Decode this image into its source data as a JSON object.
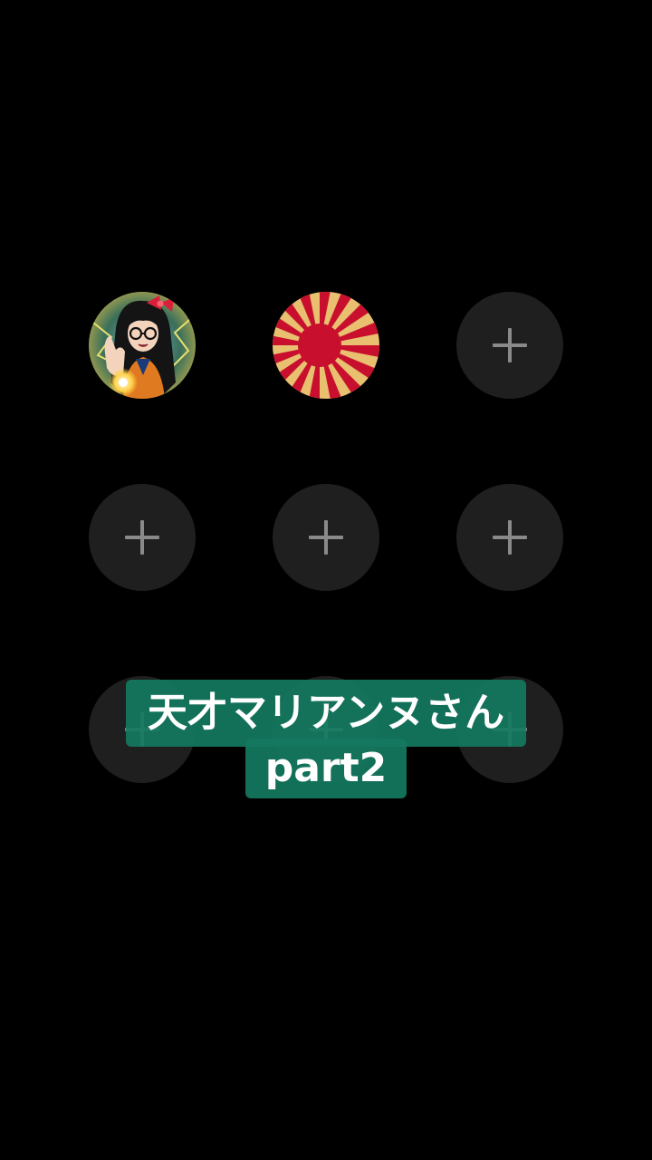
{
  "slots": [
    {
      "row": 1,
      "col": 1,
      "state": "filled",
      "icon": "anime-girl-avatar"
    },
    {
      "row": 1,
      "col": 2,
      "state": "filled",
      "icon": "rising-sun-flag"
    },
    {
      "row": 1,
      "col": 3,
      "state": "empty",
      "icon": "plus-icon"
    },
    {
      "row": 2,
      "col": 1,
      "state": "empty",
      "icon": "plus-icon"
    },
    {
      "row": 2,
      "col": 2,
      "state": "empty",
      "icon": "plus-icon"
    },
    {
      "row": 2,
      "col": 3,
      "state": "empty",
      "icon": "plus-icon"
    },
    {
      "row": 3,
      "col": 1,
      "state": "empty",
      "icon": "plus-icon"
    },
    {
      "row": 3,
      "col": 2,
      "state": "empty",
      "icon": "plus-icon"
    },
    {
      "row": 3,
      "col": 3,
      "state": "empty",
      "icon": "plus-icon"
    }
  ],
  "caption": {
    "line1": "天才マリアンヌさん",
    "line2": "part2"
  },
  "colors": {
    "background": "#000000",
    "slot_bg": "#1f1f1f",
    "plus": "#8a8a8a",
    "caption_bg": "#14785f",
    "flag_red": "#c8102e",
    "flag_gold": "#e8c070"
  }
}
